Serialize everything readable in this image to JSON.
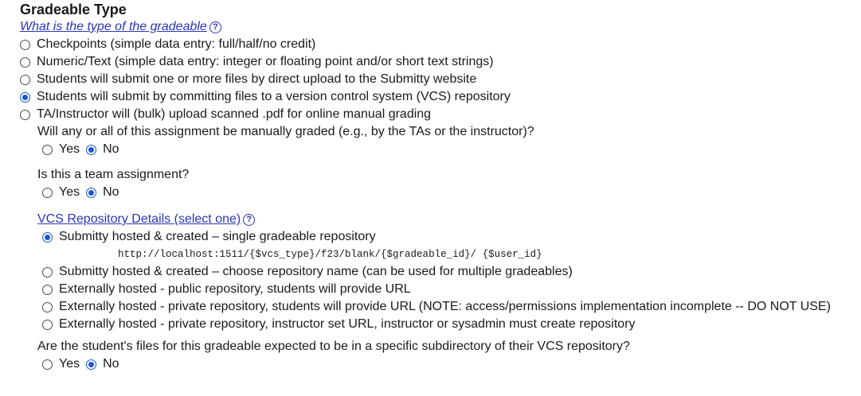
{
  "section": {
    "title": "Gradeable Type",
    "type_link": "What is the type of the gradeable",
    "help_glyph": "?"
  },
  "gradeable_types": [
    {
      "label": "Checkpoints (simple data entry: full/half/no credit)",
      "checked": false
    },
    {
      "label": "Numeric/Text (simple data entry: integer or floating point and/or short text strings)",
      "checked": false
    },
    {
      "label": "Students will submit one or more files by direct upload to the Submitty website",
      "checked": false
    },
    {
      "label": "Students will submit by committing files to a version control system (VCS) repository",
      "checked": true
    },
    {
      "label": "TA/Instructor will (bulk) upload scanned .pdf for online manual grading",
      "checked": false
    }
  ],
  "manual_grading": {
    "question": "Will any or all of this assignment be manually graded (e.g., by the TAs or the instructor)?",
    "yes": "Yes",
    "no": "No",
    "selected": "no"
  },
  "team_assignment": {
    "question": "Is this a team assignment?",
    "yes": "Yes",
    "no": "No",
    "selected": "no"
  },
  "vcs": {
    "link": "VCS Repository Details (select one)",
    "help_glyph": "?",
    "options": [
      {
        "label": "Submitty hosted & created – single gradeable repository",
        "checked": true
      },
      {
        "label": "Submitty hosted & created – choose repository name (can be used for multiple gradeables)",
        "checked": false
      },
      {
        "label": "Externally hosted - public repository, students will provide URL",
        "checked": false
      },
      {
        "label": "Externally hosted - private repository, students will provide URL (NOTE: access/permissions implementation incomplete -- DO NOT USE)",
        "checked": false
      },
      {
        "label": "Externally hosted - private repository, instructor set URL, instructor or sysadmin must create repository",
        "checked": false
      }
    ],
    "repo_url": "http://localhost:1511/{$vcs_type}/f23/blank/{$gradeable_id}/ {$user_id}"
  },
  "subdirectory": {
    "question": "Are the student's files for this gradeable expected to be in a specific subdirectory of their VCS repository?",
    "yes": "Yes",
    "no": "No",
    "selected": "no"
  },
  "colors": {
    "link": "#2a36b8",
    "radio_checked": "#1a56d6"
  }
}
